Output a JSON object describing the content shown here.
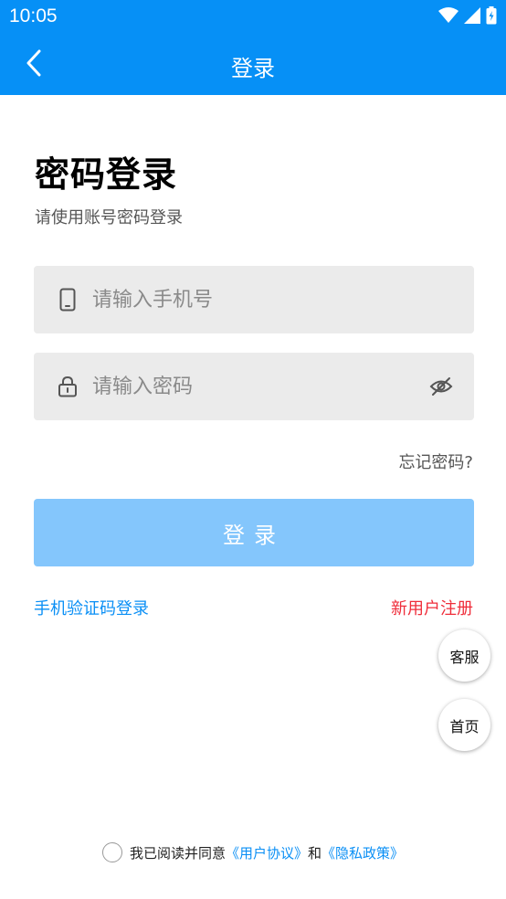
{
  "status_bar": {
    "time": "10:05",
    "icons": [
      "wifi-icon",
      "signal-icon",
      "battery-icon"
    ],
    "color": "#0690f6"
  },
  "app_bar": {
    "title": "登录",
    "back_icon": "chevron-left-icon"
  },
  "page": {
    "heading": "密码登录",
    "subheading": "请使用账号密码登录"
  },
  "form": {
    "phone": {
      "placeholder": "请输入手机号",
      "icon": "phone-icon",
      "value": ""
    },
    "password": {
      "placeholder": "请输入密码",
      "icon": "lock-icon",
      "toggle_icon": "eye-off-icon",
      "value": ""
    },
    "forgot_label": "忘记密码?",
    "submit_label": "登录"
  },
  "links": {
    "sms_login": "手机验证码登录",
    "register": "新用户注册"
  },
  "floating": {
    "service_label": "客服",
    "home_label": "首页"
  },
  "agreement": {
    "prefix": "我已阅读并同意",
    "user_agreement": "《用户协议》",
    "conjunction": "和",
    "privacy_policy": "《隐私政策》",
    "checked": false
  },
  "colors": {
    "primary": "#0690f6",
    "button_disabled": "#84c6fc",
    "link": "#0a8ff5",
    "register": "#ef2d3a",
    "field_bg": "#ebebeb"
  }
}
